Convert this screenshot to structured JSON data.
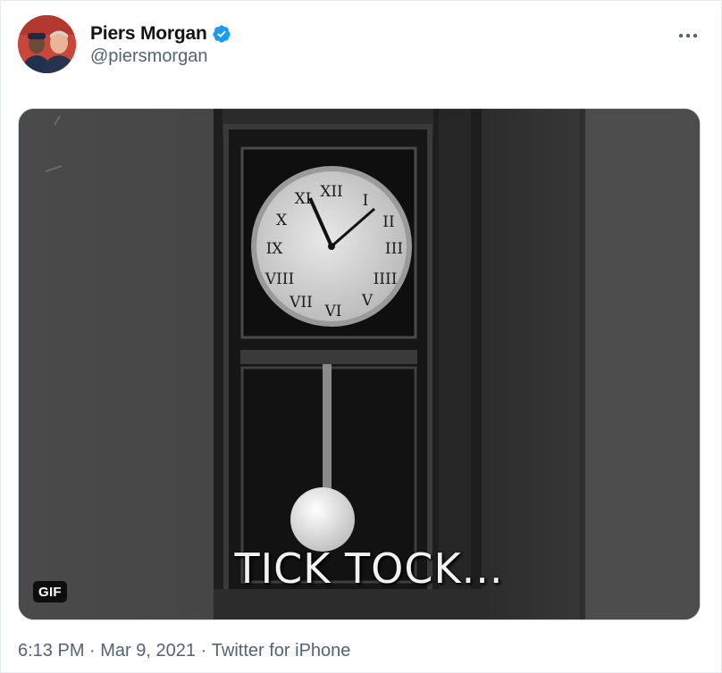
{
  "tweet": {
    "display_name": "Piers Morgan",
    "handle": "@piersmorgan",
    "media": {
      "caption": "TICK TOCK...",
      "badge": "GIF"
    },
    "meta": {
      "time": "6:13 PM",
      "separator": " · ",
      "date": "Mar 9, 2021",
      "source": "Twitter for iPhone"
    }
  },
  "colors": {
    "verified": "#1d9bf0",
    "secondary_text": "#536471"
  },
  "icons": {
    "verified": "verified-badge-icon",
    "more": "more-dots-icon"
  }
}
